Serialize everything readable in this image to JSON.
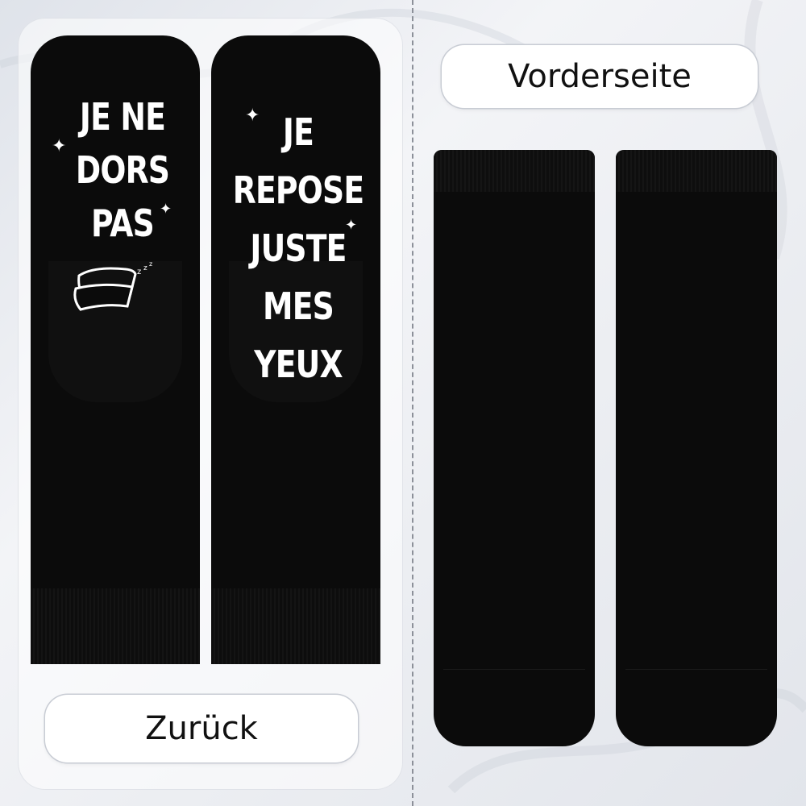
{
  "labels": {
    "back": "Zurück",
    "front": "Vorderseite"
  },
  "left_sock_text": {
    "line1": "JE NE",
    "line2": "DORS",
    "line3": "PAS",
    "zzz": "z z z"
  },
  "right_sock_text": {
    "line1": "JE",
    "line2": "REPOSE",
    "line3": "JUSTE",
    "line4": "MES YEUX"
  },
  "colors": {
    "sock": "#0b0b0b",
    "print": "#ffffff",
    "label_bg": "#ffffff",
    "label_text": "#111111"
  },
  "icons": [
    "sparkle-icon",
    "pillow-icon"
  ]
}
